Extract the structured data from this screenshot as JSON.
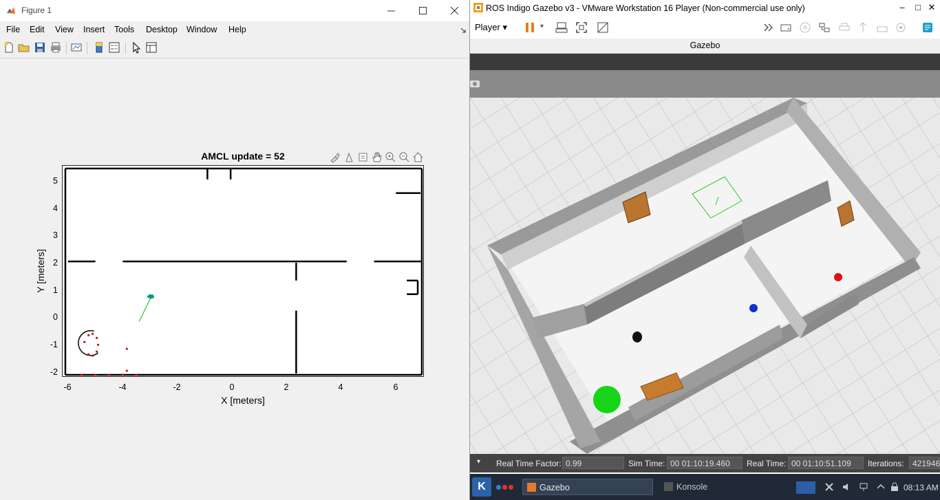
{
  "figure": {
    "title": "Figure 1",
    "menus": [
      "File",
      "Edit",
      "View",
      "Insert",
      "Tools",
      "Desktop",
      "Window",
      "Help"
    ],
    "toolbar_icons": [
      "new-figure-icon",
      "open-file-icon",
      "save-icon",
      "print-icon",
      "link-plot-icon",
      "colorbar-icon",
      "legend-icon",
      "pointer-icon",
      "property-inspector-icon"
    ],
    "axes_toolbar_icons": [
      "brush-icon",
      "data-tips-icon",
      "export-icon",
      "pan-icon",
      "zoom-in-icon",
      "zoom-out-icon",
      "home-icon"
    ],
    "plot": {
      "title": "AMCL update = 52",
      "xlabel": "X [meters]",
      "ylabel": "Y [meters]",
      "xticks": [
        "-6",
        "-4",
        "-2",
        "0",
        "2",
        "4",
        "6"
      ],
      "yticks": [
        "5",
        "4",
        "3",
        "2",
        "1",
        "0",
        "-1",
        "-2"
      ]
    }
  },
  "chart_data": {
    "type": "scatter",
    "title": "AMCL update = 52",
    "xlabel": "X [meters]",
    "ylabel": "Y [meters]",
    "xlim": [
      -6.2,
      7.0
    ],
    "ylim": [
      -2.2,
      5.5
    ],
    "grid": false,
    "map_walls": [
      {
        "from": [
          -6.1,
          5.4
        ],
        "to": [
          6.95,
          5.4
        ]
      },
      {
        "from": [
          6.95,
          5.4
        ],
        "to": [
          6.95,
          -2.15
        ]
      },
      {
        "from": [
          -6.1,
          -2.15
        ],
        "to": [
          6.95,
          -2.15
        ]
      },
      {
        "from": [
          -6.1,
          5.4
        ],
        "to": [
          -6.1,
          -2.15
        ]
      },
      {
        "from": [
          -6.0,
          2.0
        ],
        "to": [
          -5.0,
          2.0
        ]
      },
      {
        "from": [
          -4.0,
          2.0
        ],
        "to": [
          4.2,
          2.0
        ]
      },
      {
        "from": [
          5.2,
          2.0
        ],
        "to": [
          6.95,
          2.0
        ]
      },
      {
        "from": [
          2.35,
          1.95
        ],
        "to": [
          2.35,
          1.3
        ]
      },
      {
        "from": [
          2.35,
          0.2
        ],
        "to": [
          2.35,
          -2.1
        ]
      },
      {
        "from": [
          -0.9,
          5.4
        ],
        "to": [
          -0.9,
          5.0
        ]
      },
      {
        "from": [
          -0.05,
          5.4
        ],
        "to": [
          -0.05,
          5.0
        ]
      },
      {
        "from": [
          6.0,
          4.5
        ],
        "to": [
          6.9,
          4.5
        ]
      },
      {
        "from": [
          6.4,
          1.3
        ],
        "to": [
          6.8,
          1.3
        ]
      },
      {
        "from": [
          6.4,
          0.8
        ],
        "to": [
          6.8,
          0.8
        ]
      },
      {
        "from": [
          6.8,
          1.3
        ],
        "to": [
          6.8,
          0.8
        ]
      }
    ],
    "particles": [
      {
        "x": -2.95,
        "y": 0.72
      },
      {
        "x": -3.0,
        "y": 0.75
      },
      {
        "x": -2.9,
        "y": 0.7
      },
      {
        "x": -2.97,
        "y": 0.68
      },
      {
        "x": -3.05,
        "y": 0.71
      },
      {
        "x": -2.92,
        "y": 0.74
      }
    ],
    "robot_heading": {
      "from": [
        -3.4,
        -0.2
      ],
      "to": [
        -2.95,
        0.72
      ]
    },
    "laser_scan": [
      {
        "x": -5.4,
        "y": -0.95
      },
      {
        "x": -5.25,
        "y": -0.7
      },
      {
        "x": -5.1,
        "y": -0.65
      },
      {
        "x": -4.95,
        "y": -0.8
      },
      {
        "x": -4.9,
        "y": -1.05
      },
      {
        "x": -4.95,
        "y": -1.3
      },
      {
        "x": -5.1,
        "y": -1.45
      },
      {
        "x": -5.25,
        "y": -1.4
      },
      {
        "x": -3.85,
        "y": -1.2
      },
      {
        "x": -3.85,
        "y": -2.0
      },
      {
        "x": -5.5,
        "y": -2.15
      },
      {
        "x": -5.0,
        "y": -2.15
      },
      {
        "x": -4.5,
        "y": -2.15
      },
      {
        "x": -4.0,
        "y": -2.15
      },
      {
        "x": -3.5,
        "y": -2.15
      }
    ]
  },
  "vmware": {
    "title": "ROS Indigo Gazebo v3 - VMware Workstation 16 Player (Non-commercial use only)",
    "player_label": "Player",
    "gazebo_title": "Gazebo",
    "status": {
      "rtf_label": "Real Time Factor:",
      "rtf_value": "0.99",
      "sim_label": "Sim Time:",
      "sim_value": "00 01:10:19.460",
      "real_label": "Real Time:",
      "real_value": "00 01:10:51.109",
      "iter_label": "Iterations:",
      "iter_value": "421946"
    },
    "taskbar": {
      "gazebo_task": "Gazebo",
      "konsole_task": "Konsole",
      "clock": "08:13 AM"
    }
  },
  "colors": {
    "scan": "#e00000",
    "particles": "#009a8a",
    "heading": "#22cc22",
    "green_ball": "#18d418",
    "blue_ball": "#1030d0",
    "red_ball": "#e01010"
  }
}
